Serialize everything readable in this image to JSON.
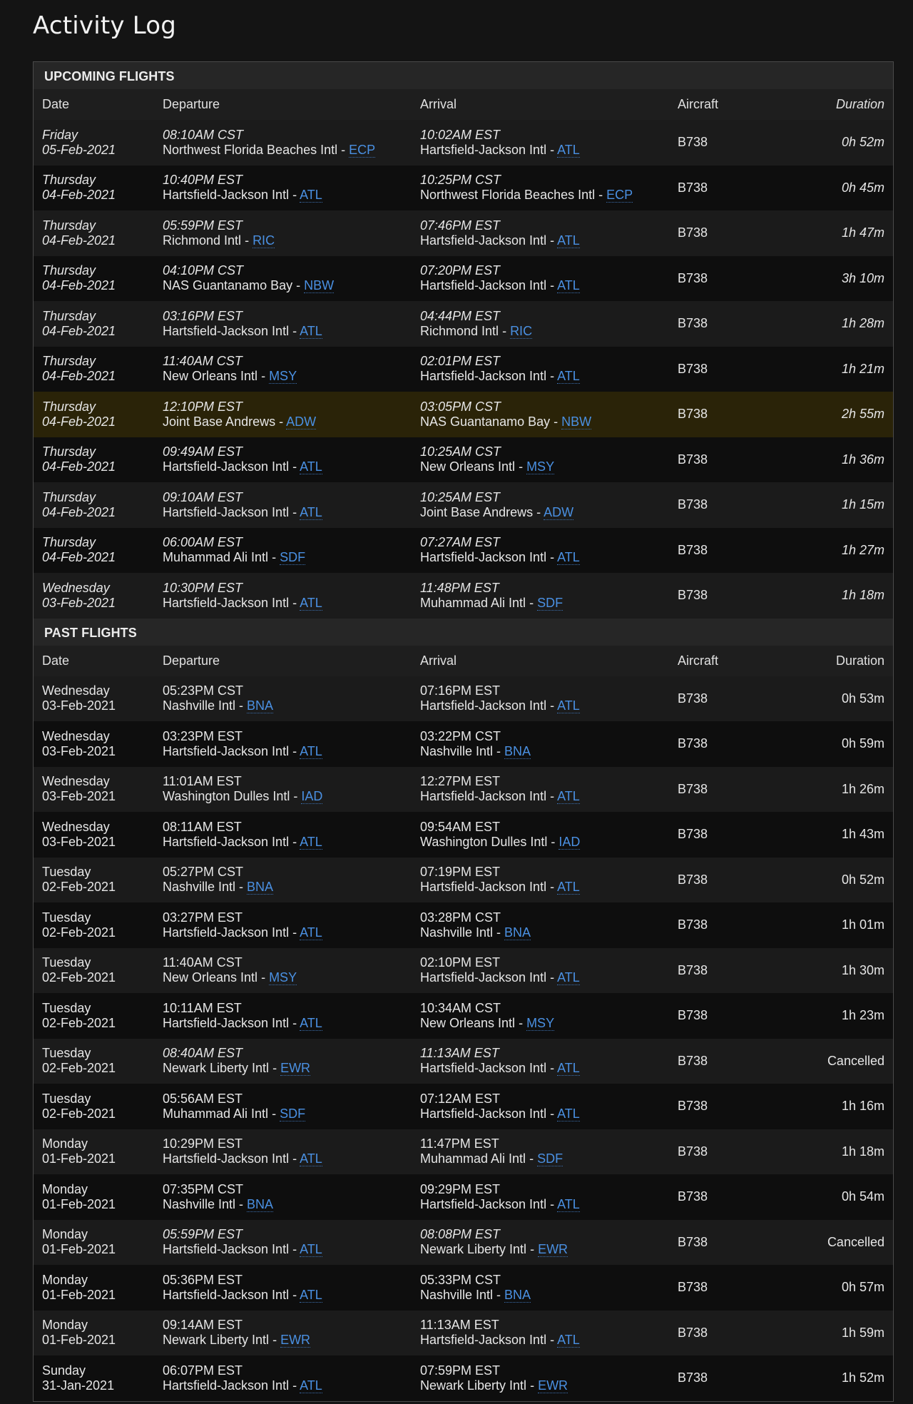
{
  "page": {
    "title": "Activity Log"
  },
  "columns": {
    "date": "Date",
    "departure": "Departure",
    "arrival": "Arrival",
    "aircraft": "Aircraft",
    "duration": "Duration"
  },
  "colors": {
    "link": "#4a90e2",
    "highlight_row": "#2a2308",
    "background": "#141414"
  },
  "upcoming": {
    "title": "UPCOMING FLIGHTS",
    "rows": [
      {
        "day": "Friday",
        "date": "05-Feb-2021",
        "dep_time": "08:10AM CST",
        "dep_airport": "Northwest Florida Beaches Intl",
        "dep_code": "ECP",
        "arr_time": "10:02AM EST",
        "arr_airport": "Hartsfield-Jackson Intl",
        "arr_code": "ATL",
        "aircraft": "B738",
        "duration": "0h 52m"
      },
      {
        "day": "Thursday",
        "date": "04-Feb-2021",
        "dep_time": "10:40PM EST",
        "dep_airport": "Hartsfield-Jackson Intl",
        "dep_code": "ATL",
        "arr_time": "10:25PM CST",
        "arr_airport": "Northwest Florida Beaches Intl",
        "arr_code": "ECP",
        "aircraft": "B738",
        "duration": "0h 45m"
      },
      {
        "day": "Thursday",
        "date": "04-Feb-2021",
        "dep_time": "05:59PM EST",
        "dep_airport": "Richmond Intl",
        "dep_code": "RIC",
        "arr_time": "07:46PM EST",
        "arr_airport": "Hartsfield-Jackson Intl",
        "arr_code": "ATL",
        "aircraft": "B738",
        "duration": "1h 47m"
      },
      {
        "day": "Thursday",
        "date": "04-Feb-2021",
        "dep_time": "04:10PM CST",
        "dep_airport": "NAS Guantanamo Bay",
        "dep_code": "NBW",
        "arr_time": "07:20PM EST",
        "arr_airport": "Hartsfield-Jackson Intl",
        "arr_code": "ATL",
        "aircraft": "B738",
        "duration": "3h 10m"
      },
      {
        "day": "Thursday",
        "date": "04-Feb-2021",
        "dep_time": "03:16PM EST",
        "dep_airport": "Hartsfield-Jackson Intl",
        "dep_code": "ATL",
        "arr_time": "04:44PM EST",
        "arr_airport": "Richmond Intl",
        "arr_code": "RIC",
        "aircraft": "B738",
        "duration": "1h 28m"
      },
      {
        "day": "Thursday",
        "date": "04-Feb-2021",
        "dep_time": "11:40AM CST",
        "dep_airport": "New Orleans Intl",
        "dep_code": "MSY",
        "arr_time": "02:01PM EST",
        "arr_airport": "Hartsfield-Jackson Intl",
        "arr_code": "ATL",
        "aircraft": "B738",
        "duration": "1h 21m"
      },
      {
        "day": "Thursday",
        "date": "04-Feb-2021",
        "dep_time": "12:10PM EST",
        "dep_airport": "Joint Base Andrews",
        "dep_code": "ADW",
        "arr_time": "03:05PM CST",
        "arr_airport": "NAS Guantanamo Bay",
        "arr_code": "NBW",
        "aircraft": "B738",
        "duration": "2h 55m",
        "highlight": true
      },
      {
        "day": "Thursday",
        "date": "04-Feb-2021",
        "dep_time": "09:49AM EST",
        "dep_airport": "Hartsfield-Jackson Intl",
        "dep_code": "ATL",
        "arr_time": "10:25AM CST",
        "arr_airport": "New Orleans Intl",
        "arr_code": "MSY",
        "aircraft": "B738",
        "duration": "1h 36m"
      },
      {
        "day": "Thursday",
        "date": "04-Feb-2021",
        "dep_time": "09:10AM EST",
        "dep_airport": "Hartsfield-Jackson Intl",
        "dep_code": "ATL",
        "arr_time": "10:25AM EST",
        "arr_airport": "Joint Base Andrews",
        "arr_code": "ADW",
        "aircraft": "B738",
        "duration": "1h 15m"
      },
      {
        "day": "Thursday",
        "date": "04-Feb-2021",
        "dep_time": "06:00AM EST",
        "dep_airport": "Muhammad Ali Intl",
        "dep_code": "SDF",
        "arr_time": "07:27AM EST",
        "arr_airport": "Hartsfield-Jackson Intl",
        "arr_code": "ATL",
        "aircraft": "B738",
        "duration": "1h 27m"
      },
      {
        "day": "Wednesday",
        "date": "03-Feb-2021",
        "dep_time": "10:30PM EST",
        "dep_airport": "Hartsfield-Jackson Intl",
        "dep_code": "ATL",
        "arr_time": "11:48PM EST",
        "arr_airport": "Muhammad Ali Intl",
        "arr_code": "SDF",
        "aircraft": "B738",
        "duration": "1h 18m"
      }
    ]
  },
  "past": {
    "title": "PAST FLIGHTS",
    "rows": [
      {
        "day": "Wednesday",
        "date": "03-Feb-2021",
        "dep_time": "05:23PM CST",
        "dep_airport": "Nashville Intl",
        "dep_code": "BNA",
        "arr_time": "07:16PM EST",
        "arr_airport": "Hartsfield-Jackson Intl",
        "arr_code": "ATL",
        "aircraft": "B738",
        "duration": "0h 53m"
      },
      {
        "day": "Wednesday",
        "date": "03-Feb-2021",
        "dep_time": "03:23PM EST",
        "dep_airport": "Hartsfield-Jackson Intl",
        "dep_code": "ATL",
        "arr_time": "03:22PM CST",
        "arr_airport": "Nashville Intl",
        "arr_code": "BNA",
        "aircraft": "B738",
        "duration": "0h 59m"
      },
      {
        "day": "Wednesday",
        "date": "03-Feb-2021",
        "dep_time": "11:01AM EST",
        "dep_airport": "Washington Dulles Intl",
        "dep_code": "IAD",
        "arr_time": "12:27PM EST",
        "arr_airport": "Hartsfield-Jackson Intl",
        "arr_code": "ATL",
        "aircraft": "B738",
        "duration": "1h 26m"
      },
      {
        "day": "Wednesday",
        "date": "03-Feb-2021",
        "dep_time": "08:11AM EST",
        "dep_airport": "Hartsfield-Jackson Intl",
        "dep_code": "ATL",
        "arr_time": "09:54AM EST",
        "arr_airport": "Washington Dulles Intl",
        "arr_code": "IAD",
        "aircraft": "B738",
        "duration": "1h 43m"
      },
      {
        "day": "Tuesday",
        "date": "02-Feb-2021",
        "dep_time": "05:27PM CST",
        "dep_airport": "Nashville Intl",
        "dep_code": "BNA",
        "arr_time": "07:19PM EST",
        "arr_airport": "Hartsfield-Jackson Intl",
        "arr_code": "ATL",
        "aircraft": "B738",
        "duration": "0h 52m"
      },
      {
        "day": "Tuesday",
        "date": "02-Feb-2021",
        "dep_time": "03:27PM EST",
        "dep_airport": "Hartsfield-Jackson Intl",
        "dep_code": "ATL",
        "arr_time": "03:28PM CST",
        "arr_airport": "Nashville Intl",
        "arr_code": "BNA",
        "aircraft": "B738",
        "duration": "1h 01m"
      },
      {
        "day": "Tuesday",
        "date": "02-Feb-2021",
        "dep_time": "11:40AM CST",
        "dep_airport": "New Orleans Intl",
        "dep_code": "MSY",
        "arr_time": "02:10PM EST",
        "arr_airport": "Hartsfield-Jackson Intl",
        "arr_code": "ATL",
        "aircraft": "B738",
        "duration": "1h 30m"
      },
      {
        "day": "Tuesday",
        "date": "02-Feb-2021",
        "dep_time": "10:11AM EST",
        "dep_airport": "Hartsfield-Jackson Intl",
        "dep_code": "ATL",
        "arr_time": "10:34AM CST",
        "arr_airport": "New Orleans Intl",
        "arr_code": "MSY",
        "aircraft": "B738",
        "duration": "1h 23m"
      },
      {
        "day": "Tuesday",
        "date": "02-Feb-2021",
        "dep_time": "08:40AM EST",
        "dep_airport": "Newark Liberty Intl",
        "dep_code": "EWR",
        "arr_time": "11:13AM EST",
        "arr_airport": "Hartsfield-Jackson Intl",
        "arr_code": "ATL",
        "aircraft": "B738",
        "duration": "Cancelled",
        "italic_times": true
      },
      {
        "day": "Tuesday",
        "date": "02-Feb-2021",
        "dep_time": "05:56AM EST",
        "dep_airport": "Muhammad Ali Intl",
        "dep_code": "SDF",
        "arr_time": "07:12AM EST",
        "arr_airport": "Hartsfield-Jackson Intl",
        "arr_code": "ATL",
        "aircraft": "B738",
        "duration": "1h 16m"
      },
      {
        "day": "Monday",
        "date": "01-Feb-2021",
        "dep_time": "10:29PM EST",
        "dep_airport": "Hartsfield-Jackson Intl",
        "dep_code": "ATL",
        "arr_time": "11:47PM EST",
        "arr_airport": "Muhammad Ali Intl",
        "arr_code": "SDF",
        "aircraft": "B738",
        "duration": "1h 18m"
      },
      {
        "day": "Monday",
        "date": "01-Feb-2021",
        "dep_time": "07:35PM CST",
        "dep_airport": "Nashville Intl",
        "dep_code": "BNA",
        "arr_time": "09:29PM EST",
        "arr_airport": "Hartsfield-Jackson Intl",
        "arr_code": "ATL",
        "aircraft": "B738",
        "duration": "0h 54m"
      },
      {
        "day": "Monday",
        "date": "01-Feb-2021",
        "dep_time": "05:59PM EST",
        "dep_airport": "Hartsfield-Jackson Intl",
        "dep_code": "ATL",
        "arr_time": "08:08PM EST",
        "arr_airport": "Newark Liberty Intl",
        "arr_code": "EWR",
        "aircraft": "B738",
        "duration": "Cancelled",
        "italic_times": true
      },
      {
        "day": "Monday",
        "date": "01-Feb-2021",
        "dep_time": "05:36PM EST",
        "dep_airport": "Hartsfield-Jackson Intl",
        "dep_code": "ATL",
        "arr_time": "05:33PM CST",
        "arr_airport": "Nashville Intl",
        "arr_code": "BNA",
        "aircraft": "B738",
        "duration": "0h 57m"
      },
      {
        "day": "Monday",
        "date": "01-Feb-2021",
        "dep_time": "09:14AM EST",
        "dep_airport": "Newark Liberty Intl",
        "dep_code": "EWR",
        "arr_time": "11:13AM EST",
        "arr_airport": "Hartsfield-Jackson Intl",
        "arr_code": "ATL",
        "aircraft": "B738",
        "duration": "1h 59m"
      },
      {
        "day": "Sunday",
        "date": "31-Jan-2021",
        "dep_time": "06:07PM EST",
        "dep_airport": "Hartsfield-Jackson Intl",
        "dep_code": "ATL",
        "arr_time": "07:59PM EST",
        "arr_airport": "Newark Liberty Intl",
        "arr_code": "EWR",
        "aircraft": "B738",
        "duration": "1h 52m"
      }
    ]
  }
}
